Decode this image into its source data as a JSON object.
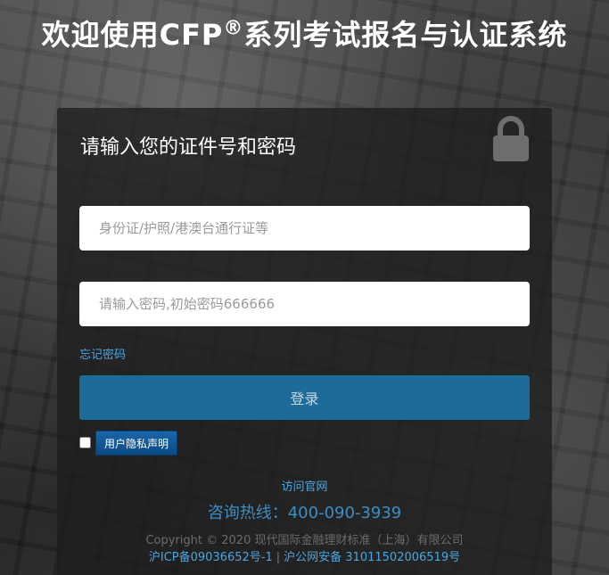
{
  "header": {
    "title_before": "欢迎使用CFP",
    "title_reg": "®",
    "title_after": "系列考试报名与认证系统"
  },
  "login": {
    "heading": "请输入您的证件号和密码",
    "lock_icon": "lock-icon",
    "id_placeholder": "身份证/护照/港澳台通行证等",
    "id_value": "",
    "password_placeholder": "请输入密码,初始密码666666",
    "password_value": "",
    "forgot_label": "忘记密码",
    "submit_label": "登录",
    "privacy_label": "用户隐私声明",
    "privacy_checked": false
  },
  "footer": {
    "visit_label": "访问官网",
    "hotline": "咨询热线：400-090-3939",
    "copyright": "Copyright © 2020 现代国际金融理财标准（上海）有限公司",
    "icp": "沪ICP备09036652号-1",
    "separator": "|",
    "police": "沪公网安备 31011502006519号"
  },
  "colors": {
    "accent": "#1d6b98",
    "link": "#4aa6e0",
    "privacy_button": "#0c4a85"
  }
}
